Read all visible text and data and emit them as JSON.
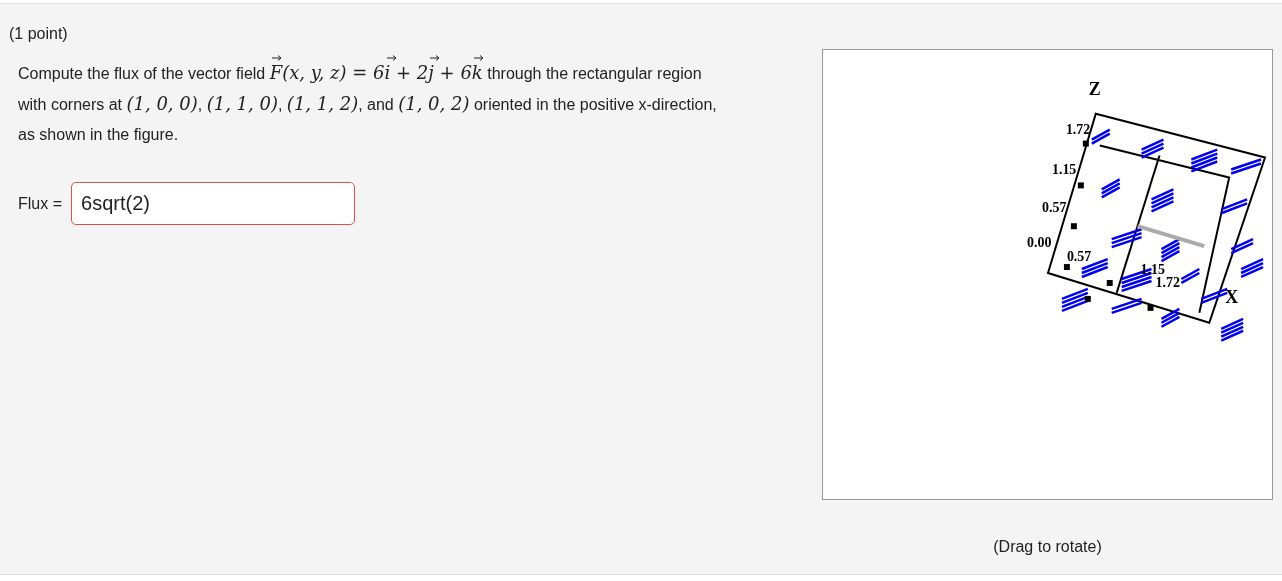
{
  "points": "(1 point)",
  "question": [
    {
      "kind": "text",
      "text": "Compute the flux of the vector field "
    },
    {
      "kind": "vector",
      "text": "F"
    },
    {
      "kind": "math",
      "text": "(x, y, z) = 6"
    },
    {
      "kind": "vector",
      "text": "i"
    },
    {
      "kind": "math",
      "text": " + 2"
    },
    {
      "kind": "vector",
      "text": "j"
    },
    {
      "kind": "math",
      "text": " + 6"
    },
    {
      "kind": "vector",
      "text": "k"
    },
    {
      "kind": "text",
      "text": " through the rectangular region with corners at "
    },
    {
      "kind": "math",
      "text": "(1, 0, 0)"
    },
    {
      "kind": "text",
      "text": ", "
    },
    {
      "kind": "math",
      "text": "(1, 1, 0)"
    },
    {
      "kind": "text",
      "text": ", "
    },
    {
      "kind": "math",
      "text": "(1, 1, 2)"
    },
    {
      "kind": "text",
      "text": ", and "
    },
    {
      "kind": "math",
      "text": "(1, 0, 2)"
    },
    {
      "kind": "text",
      "text": " oriented in the positive x-direction, as shown in the figure."
    }
  ],
  "answer": {
    "label": "Flux =",
    "value": "6sqrt(2)",
    "incorrect": true
  },
  "figure": {
    "axis_labels": [
      "Z",
      "X"
    ],
    "z_ticks": [
      "1.72",
      "1.15",
      "0.57",
      "0.00"
    ],
    "x_ticks": [
      "0.57",
      "1.15",
      "1.72"
    ],
    "caption": "(Drag to rotate)"
  }
}
